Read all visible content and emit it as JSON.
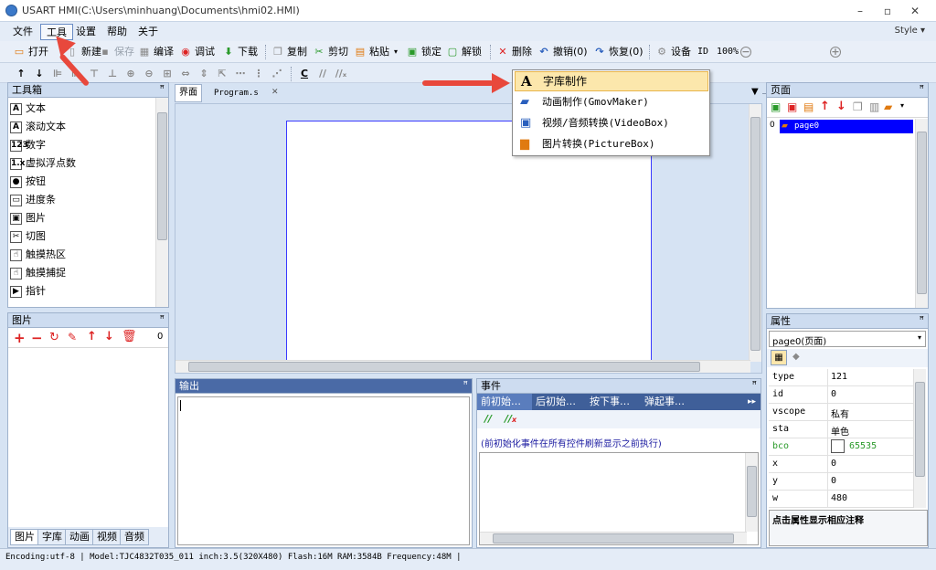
{
  "window": {
    "title": "USART HMI(C:\\Users\\minhuang\\Documents\\hmi02.HMI)",
    "minimize": "–",
    "maximize": "▫",
    "close": "✕"
  },
  "menu": {
    "items": [
      "文件",
      "工具",
      "设置",
      "帮助",
      "关于"
    ],
    "style_label": "Style ▾"
  },
  "toolbar1": {
    "open": "打开",
    "new": "新建",
    "save": "保存",
    "compile": "编译",
    "debug": "调试",
    "download": "下载",
    "copy": "复制",
    "cut": "剪切",
    "paste": "粘贴",
    "lock": "锁定",
    "unlock": "解锁",
    "delete": "删除",
    "undo": "撤销(0)",
    "redo": "恢复(0)",
    "settings": "设备",
    "id": "ID",
    "zoom": "100%"
  },
  "toolbox": {
    "title": "工具箱",
    "items": [
      "文本",
      "滚动文本",
      "数字",
      "虚拟浮点数",
      "按钮",
      "进度条",
      "图片",
      "切图",
      "触摸热区",
      "触摸捕捉",
      "指针"
    ],
    "icons": [
      "A",
      "A",
      "123",
      "1.x",
      "●",
      "▭",
      "▣",
      "✂",
      "☝",
      "☝",
      "▶"
    ]
  },
  "pictures": {
    "title": "图片",
    "count": "0",
    "tabs": [
      "图片",
      "字库",
      "动画",
      "视频",
      "音频"
    ]
  },
  "editor": {
    "tabs": [
      "界面",
      "Program.s"
    ],
    "close_icon": "✕"
  },
  "output": {
    "title": "输出"
  },
  "events": {
    "title": "事件",
    "tabs": [
      "前初始…",
      "后初始…",
      "按下事…",
      "弹起事…"
    ],
    "note": "(前初始化事件在所有控件刷新显示之前执行)"
  },
  "pages": {
    "title": "页面",
    "index": "0",
    "item": "page0"
  },
  "properties": {
    "title": "属性",
    "selector": "page0(页面)",
    "rows": [
      {
        "k": "type",
        "v": "121"
      },
      {
        "k": "id",
        "v": "0"
      },
      {
        "k": "vscope",
        "v": "私有"
      },
      {
        "k": "sta",
        "v": "单色"
      },
      {
        "k": "bco",
        "v": "65535"
      },
      {
        "k": "x",
        "v": "0"
      },
      {
        "k": "y",
        "v": "0"
      },
      {
        "k": "w",
        "v": "480"
      }
    ],
    "hint": "点击属性显示相应注释"
  },
  "dropdown": {
    "items": [
      "字库制作",
      "动画制作(GmovMaker)",
      "视频/音频转换(VideoBox)",
      "图片转换(PictureBox)"
    ]
  },
  "status": {
    "text": "Encoding:utf-8  | Model:TJC4832T035_011  inch:3.5(320X480) Flash:16M RAM:3584B Frequency:48M   |"
  },
  "colors": {
    "accent": "#e8483c",
    "selection": "#0000ff",
    "highlight": "#fce7ac"
  }
}
